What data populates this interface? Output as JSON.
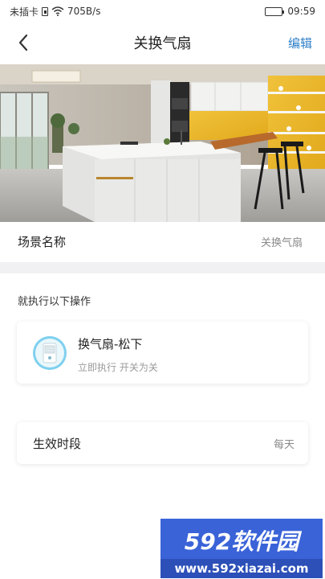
{
  "status_bar": {
    "carrier": "未插卡",
    "speed": "705B/s",
    "time": "09:59",
    "icons": [
      "sim-icon",
      "wifi-icon",
      "battery-icon"
    ]
  },
  "nav": {
    "title": "关换气扇",
    "edit_label": "编辑",
    "back_icon": "chevron-left-icon"
  },
  "hero": {
    "icon": "kitchen-photo"
  },
  "scene": {
    "label": "场景名称",
    "value": "关换气扇"
  },
  "actions": {
    "section_title": "就执行以下操作",
    "items": [
      {
        "device_name": "换气扇-松下",
        "description": "立即执行 开关为关",
        "icon": "ventilation-fan-icon"
      }
    ]
  },
  "period": {
    "label": "生效时段",
    "value": "每天"
  },
  "watermark": {
    "brand": "592软件园",
    "url": "www.592xiazai.com"
  },
  "colors": {
    "accent": "#2f7fc8",
    "device_ring": "#7fd0ee",
    "band": "#f1f1f3",
    "watermark_bg": "#3a63d8"
  }
}
